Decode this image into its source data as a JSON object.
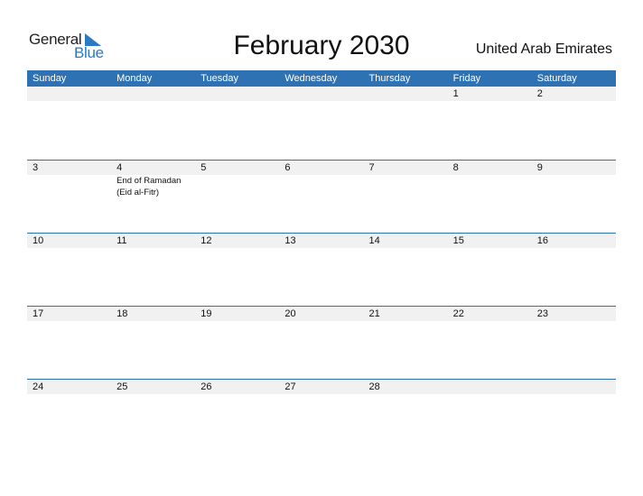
{
  "logo": {
    "word1": "General",
    "word2": "Blue",
    "icon": "triangle-flag-icon"
  },
  "header": {
    "title": "February 2030",
    "country": "United Arab Emirates"
  },
  "colors": {
    "accent": "#2f72b4",
    "band": "#f1f1f1",
    "logo_blue": "#2a7ac4"
  },
  "weekdays": [
    "Sunday",
    "Monday",
    "Tuesday",
    "Wednesday",
    "Thursday",
    "Friday",
    "Saturday"
  ],
  "weeks": [
    [
      {
        "day": ""
      },
      {
        "day": ""
      },
      {
        "day": ""
      },
      {
        "day": ""
      },
      {
        "day": ""
      },
      {
        "day": "1"
      },
      {
        "day": "2"
      }
    ],
    [
      {
        "day": "3"
      },
      {
        "day": "4",
        "events": [
          "End of Ramadan",
          "(Eid al-Fitr)"
        ]
      },
      {
        "day": "5"
      },
      {
        "day": "6"
      },
      {
        "day": "7"
      },
      {
        "day": "8"
      },
      {
        "day": "9"
      }
    ],
    [
      {
        "day": "10"
      },
      {
        "day": "11"
      },
      {
        "day": "12"
      },
      {
        "day": "13"
      },
      {
        "day": "14"
      },
      {
        "day": "15"
      },
      {
        "day": "16"
      }
    ],
    [
      {
        "day": "17"
      },
      {
        "day": "18"
      },
      {
        "day": "19"
      },
      {
        "day": "20"
      },
      {
        "day": "21"
      },
      {
        "day": "22"
      },
      {
        "day": "23"
      }
    ],
    [
      {
        "day": "24"
      },
      {
        "day": "25"
      },
      {
        "day": "26"
      },
      {
        "day": "27"
      },
      {
        "day": "28"
      },
      {
        "day": ""
      },
      {
        "day": ""
      }
    ]
  ]
}
